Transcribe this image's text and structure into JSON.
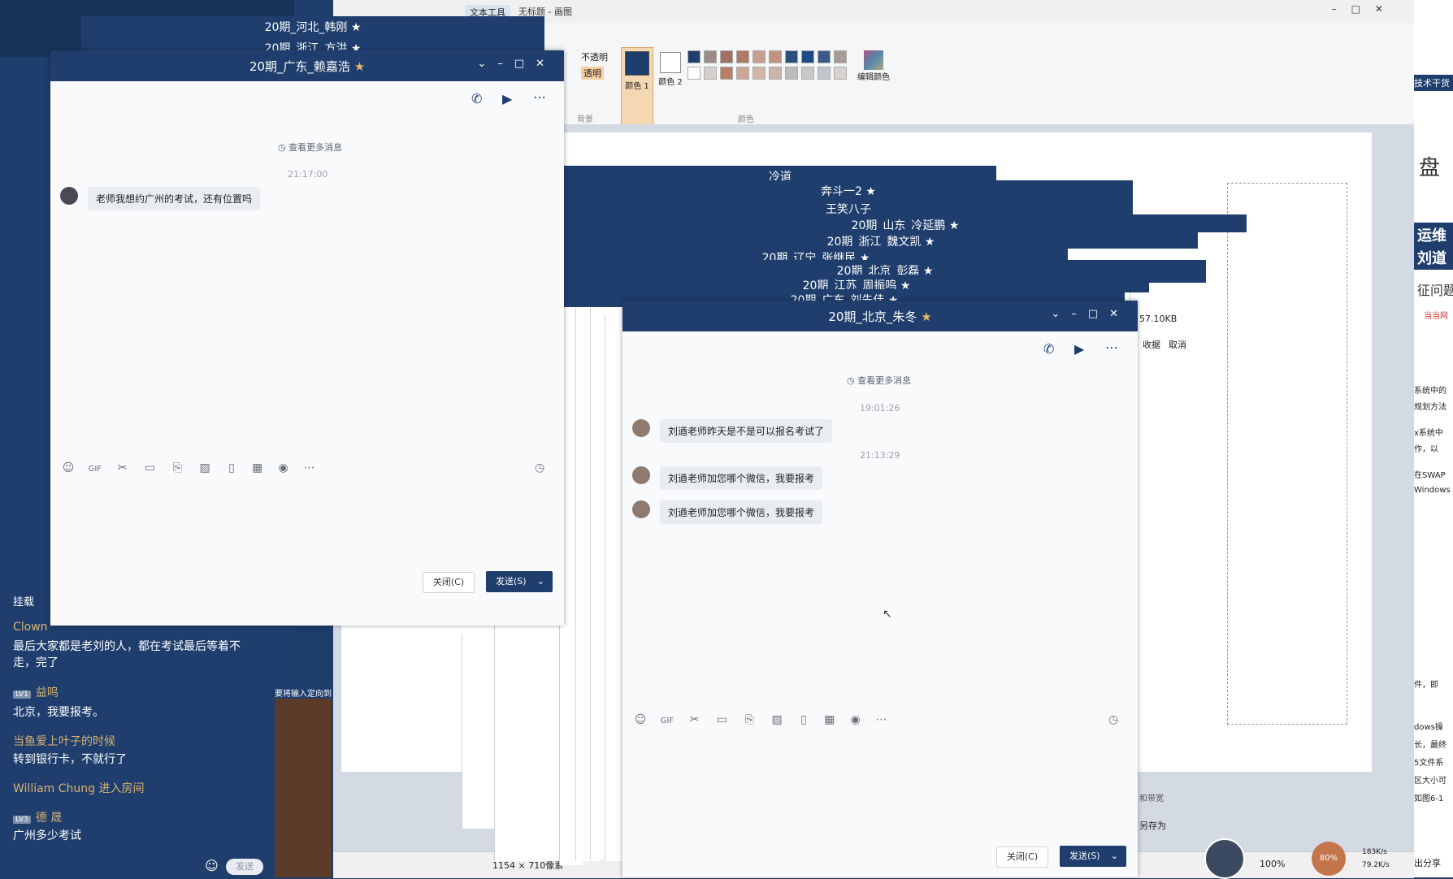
{
  "paint": {
    "title": "无标题 - 画图",
    "tab_text_tools": "文本工具",
    "opaque_label": "不透明",
    "transparent_label": "透明",
    "color1_label": "颜色 1",
    "color2_label": "颜色 2",
    "edit_colors_label": "编辑颜色",
    "group_bg": "背景",
    "group_colors": "颜色",
    "canvas_size": "1154 × 710像素",
    "file_size": "57.10KB",
    "zoom": "100%",
    "accept_label": "收据",
    "cancel_label": "取消",
    "palette": [
      "#1f3e6d",
      "#9d8a86",
      "#a07060",
      "#b07a66",
      "#c6a090",
      "#c29383",
      "#2a4f7c",
      "#204a86",
      "#3a5a8a",
      "#a89a94",
      "#ffffff",
      "#d6cfcc",
      "#b97d62",
      "#cda796",
      "#d2b5a8",
      "#c9b4a8",
      "#bcbcbc",
      "#c9c9c9",
      "#bfc6cf",
      "#dad2cf"
    ]
  },
  "stack_titles": [
    "20期_河北_韩刚",
    "20期_浙江_方洪",
    "冷道",
    "奔斗一2",
    "王笑八子",
    "20期_山东_冷延鹏",
    "20期_浙江_魏文凯",
    "20期_辽宁_张继民",
    "20期_北京_彭磊",
    "20期_江苏_周振鸣",
    "20期_广东_刘先佳"
  ],
  "win_left": {
    "title": "20期_广东_赖嘉浩",
    "view_more": "查看更多消息",
    "time1": "21:17:00",
    "msg1": "老师我想约广州的考试，还有位置吗",
    "close_btn": "关闭(C)",
    "send_btn": "发送(S)"
  },
  "win_right": {
    "title": "20期_北京_朱冬",
    "view_more": "查看更多消息",
    "time1": "19:01:26",
    "msg1": "刘遒老师昨天是不是可以报名考试了",
    "time2": "21:13:29",
    "msg2": "刘遒老师加您哪个微信，我要报考",
    "msg3": "刘遒老师加您哪个微信，我要报考",
    "close_btn": "关闭(C)",
    "send_btn": "发送(S)"
  },
  "sidebar": {
    "items": [
      {
        "name": "Clown",
        "text": "最后大家都是老刘的人，都在考试最后等着不走，完了"
      },
      {
        "name": "益鸣",
        "level": "LV1",
        "text": "北京，我要报考。"
      },
      {
        "name": "当鱼爱上叶子的时候",
        "text": "转到银行卡，不就行了"
      },
      {
        "name": "William Chung 进入房间",
        "text": ""
      },
      {
        "name": "德 晟",
        "level": "LV3",
        "text": "广州多少考试"
      }
    ],
    "send_label": "发送",
    "partial_label": "挂载",
    "trunc_line": "要将输入定向到"
  },
  "right_panel": {
    "heading": "技术干货",
    "partial_title": "盘",
    "blue_box1": "运维",
    "blue_box2": "刘道",
    "sub": "征问题",
    "small1": "当当网",
    "lines": [
      "系统中的",
      "规划方法",
      "x系统中",
      "作，以",
      "在SWAP",
      "Windows"
    ],
    "lower": [
      "件，即",
      "dows操",
      "长，最终",
      "5文件系",
      "区大小可",
      "如图6-1"
    ],
    "share": "出分享",
    "ring_value": "80%",
    "speed_up": "183K/s",
    "speed_down": "79.2K/s",
    "bandwidth": "和带宽",
    "save_as": "另存为"
  }
}
